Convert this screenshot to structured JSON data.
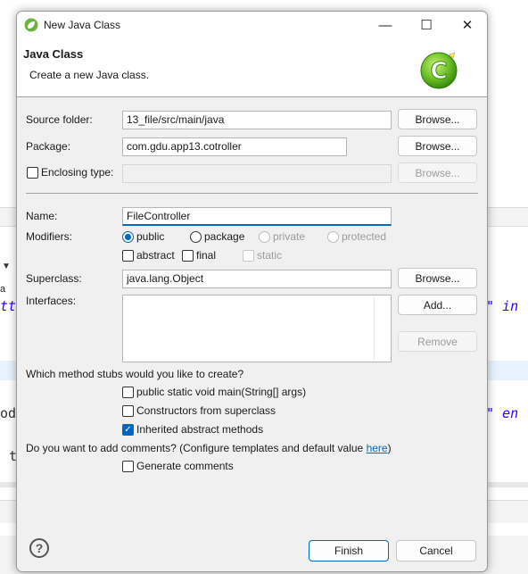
{
  "background": {
    "code_lines": [
      "tt",
      "\" in",
      "od",
      "\" en",
      "t"
    ],
    "tab_char": "a"
  },
  "dialog": {
    "title": "New Java Class",
    "controls": {
      "minimize": "—",
      "maximize": "☐",
      "close": "✕"
    },
    "header": {
      "title": "Java Class",
      "description": "Create a new Java class."
    },
    "source_folder": {
      "label": "Source folder:",
      "value": "13_file/src/main/java",
      "browse": "Browse..."
    },
    "package": {
      "label": "Package:",
      "value": "com.gdu.app13.cotroller",
      "browse": "Browse..."
    },
    "enclosing_type": {
      "label": "Enclosing type:",
      "value": "",
      "browse": "Browse..."
    },
    "name": {
      "label": "Name:",
      "value": "FileController"
    },
    "modifiers": {
      "label": "Modifiers:",
      "access": [
        "public",
        "package",
        "private",
        "protected"
      ],
      "selected": "public",
      "abstract": "abstract",
      "final": "final",
      "static": "static"
    },
    "superclass": {
      "label": "Superclass:",
      "value": "java.lang.Object",
      "browse": "Browse..."
    },
    "interfaces": {
      "label": "Interfaces:",
      "add": "Add...",
      "remove": "Remove"
    },
    "stubs": {
      "question": "Which method stubs would you like to create?",
      "main": "public static void main(String[] args)",
      "constructors": "Constructors from superclass",
      "inherited": "Inherited abstract methods"
    },
    "comments": {
      "question": "Do you want to add comments? (Configure templates and default value ",
      "link": "here",
      "close_paren": ")",
      "generate": "Generate comments"
    },
    "footer": {
      "help": "?",
      "finish": "Finish",
      "cancel": "Cancel"
    }
  },
  "colors": {
    "accent": "#0067c0",
    "spring_green": "#6db33f"
  }
}
